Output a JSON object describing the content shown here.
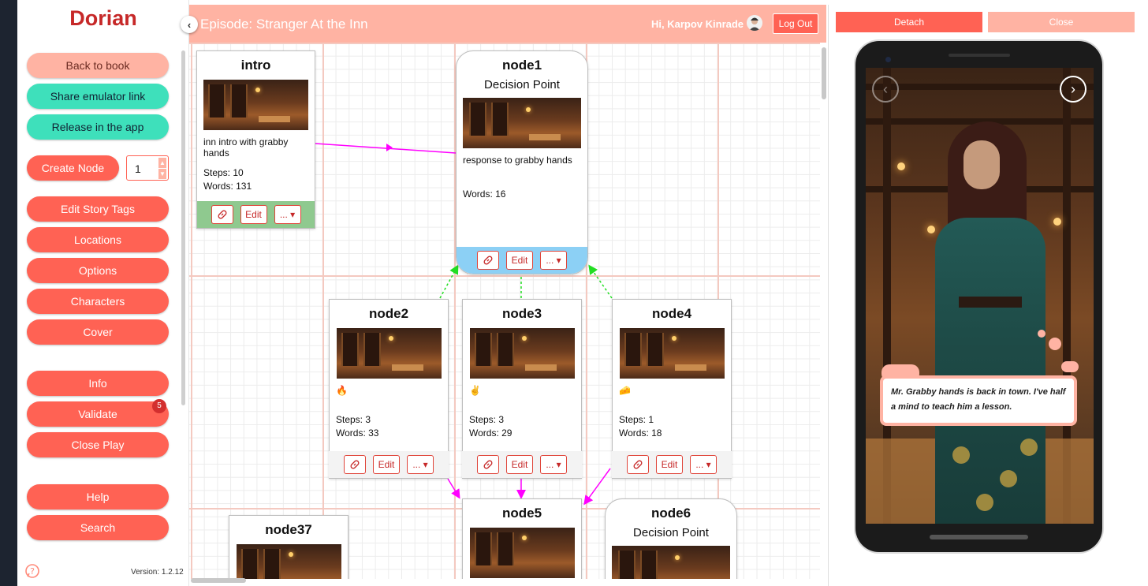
{
  "sidebar": {
    "brand": "Dorian",
    "back_to_book": "Back to book",
    "share_emulator_link": "Share emulator link",
    "release_in_app": "Release in the app",
    "create_node": "Create Node",
    "create_node_count": "1",
    "edit_story_tags": "Edit Story Tags",
    "locations": "Locations",
    "options": "Options",
    "characters": "Characters",
    "cover": "Cover",
    "info": "Info",
    "validate": "Validate",
    "validate_badge": "5",
    "close_play": "Close Play",
    "help": "Help",
    "search": "Search",
    "version": "Version: 1.2.12"
  },
  "header": {
    "episode_title": "Episode: Stranger At the Inn",
    "greeting": "Hi, Karpov Kinrade",
    "logout": "Log Out"
  },
  "nodes": [
    {
      "title": "intro",
      "desc": "inn intro with grabby hands",
      "steps": "Steps: 10",
      "words": "Words: 131"
    },
    {
      "title": "node1",
      "subtitle": "Decision Point",
      "desc": "response to grabby hands",
      "words": "Words: 16"
    },
    {
      "title": "node2",
      "desc": "🔥",
      "steps": "Steps: 3",
      "words": "Words: 33"
    },
    {
      "title": "node3",
      "desc": "✌️",
      "steps": "Steps: 3",
      "words": "Words: 29"
    },
    {
      "title": "node4",
      "desc": "🧀",
      "steps": "Steps: 1",
      "words": "Words: 18"
    },
    {
      "title": "node5"
    },
    {
      "title": "node6",
      "subtitle": "Decision Point"
    },
    {
      "title": "node37"
    }
  ],
  "node_actions": {
    "edit": "Edit",
    "more": "... ▾"
  },
  "preview": {
    "detach": "Detach",
    "close": "Close",
    "dialogue": "Mr. Grabby hands is back in town. I've half a mind to teach him a lesson."
  },
  "colors": {
    "accent": "#ff6254",
    "accent_light": "#ffb3a3",
    "teal": "#3ee0bb",
    "brand": "#c62828",
    "edge_magenta": "#ff00ff",
    "edge_green": "#22dd22",
    "intro_footer": "#8fc98f",
    "node1_footer": "#8cd0f5"
  }
}
